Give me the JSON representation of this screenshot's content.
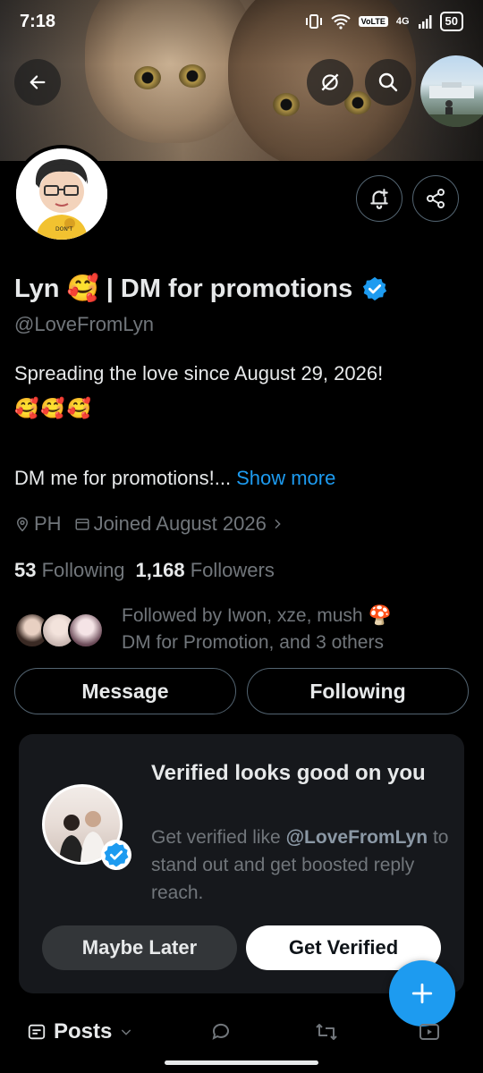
{
  "status_bar": {
    "time": "7:18",
    "volte": "VoLTE",
    "network": "4G",
    "battery": "50"
  },
  "profile": {
    "name": "Lyn 🥰 | DM for promotions",
    "handle": "@LoveFromLyn",
    "bio_line1": "Spreading the love since August 29, 2026!",
    "bio_emojis": [
      "🥰",
      "🥰",
      "🥰"
    ],
    "bio_line2": "DM me for promotions!...",
    "show_more": "Show more",
    "location": "PH",
    "joined": "Joined August 2026",
    "following_count": "53",
    "following_label": "Following",
    "followers_count": "1,168",
    "followers_label": "Followers",
    "followed_by_line1": "Followed by Iwon, xze, mush 🍄",
    "followed_by_line2": "DM for Promotion, and 3 others"
  },
  "actions": {
    "message": "Message",
    "following": "Following"
  },
  "promo": {
    "title": "Verified looks good on you",
    "desc_prefix": "Get verified like",
    "desc_handle": "@LoveFromLyn",
    "desc_suffix": "to stand out and get boosted reply reach.",
    "maybe_later": "Maybe Later",
    "get_verified": "Get Verified"
  },
  "tabs": {
    "posts": "Posts"
  },
  "colors": {
    "accent": "#1d9bf0",
    "muted": "#71767b",
    "text": "#e7e9ea",
    "background": "#000000"
  }
}
